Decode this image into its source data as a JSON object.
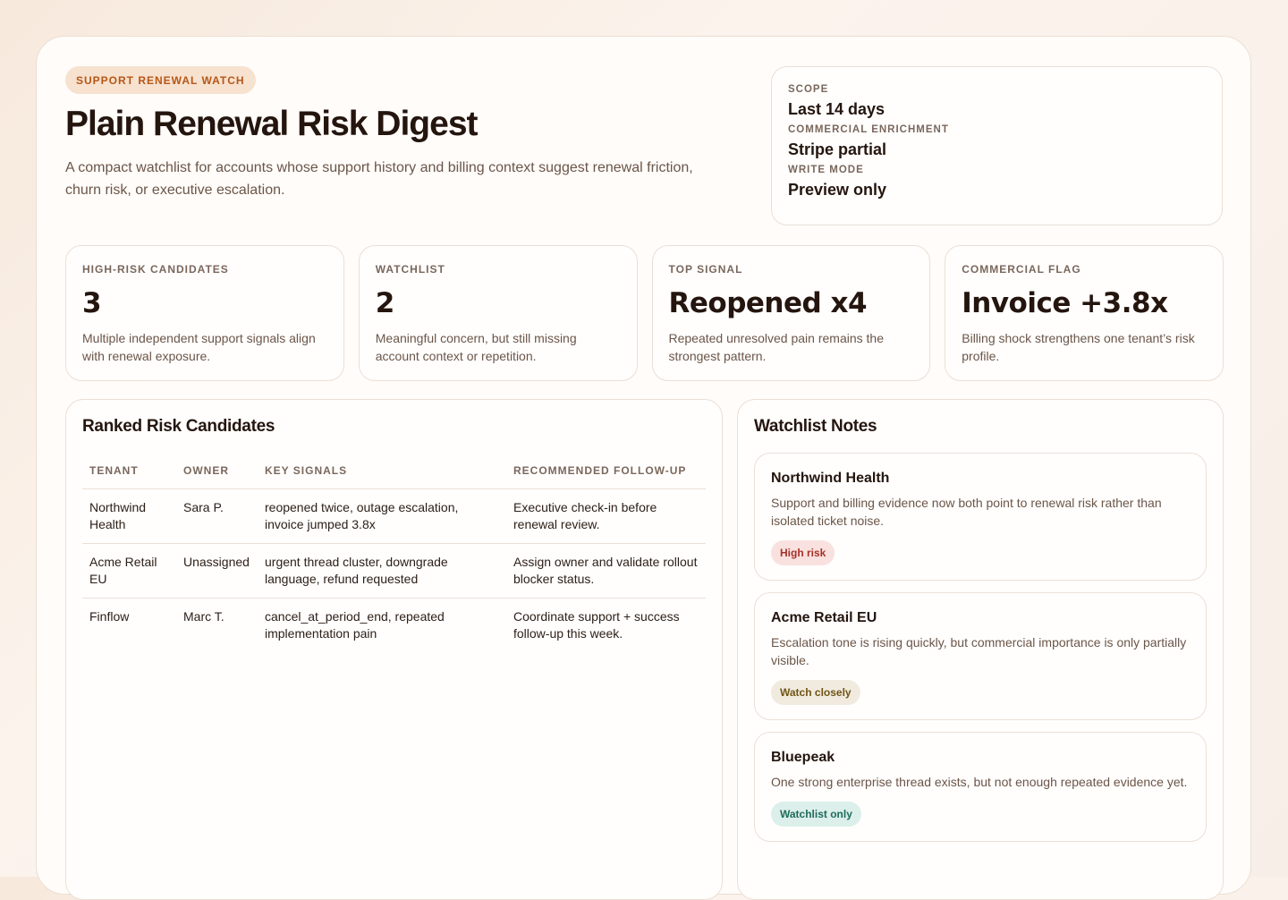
{
  "header": {
    "eyebrow": "SUPPORT RENEWAL WATCH",
    "title": "Plain Renewal Risk Digest",
    "subtitle": "A compact watchlist for accounts whose support history and billing context suggest renewal friction, churn risk, or executive escalation."
  },
  "scope": {
    "items": [
      {
        "label": "SCOPE",
        "value": "Last 14 days"
      },
      {
        "label": "COMMERCIAL ENRICHMENT",
        "value": "Stripe partial"
      },
      {
        "label": "WRITE MODE",
        "value": "Preview only"
      }
    ]
  },
  "stats": [
    {
      "label": "HIGH-RISK CANDIDATES",
      "value": "3",
      "desc": "Multiple independent support signals align with renewal exposure."
    },
    {
      "label": "WATCHLIST",
      "value": "2",
      "desc": "Meaningful concern, but still missing account context or repetition."
    },
    {
      "label": "TOP SIGNAL",
      "value": "Reopened x4",
      "desc": "Repeated unresolved pain remains the strongest pattern."
    },
    {
      "label": "COMMERCIAL FLAG",
      "value": "Invoice +3.8x",
      "desc": "Billing shock strengthens one tenant’s risk profile."
    }
  ],
  "candidates": {
    "title": "Ranked Risk Candidates",
    "columns": [
      "TENANT",
      "OWNER",
      "KEY SIGNALS",
      "RECOMMENDED FOLLOW-UP"
    ],
    "rows": [
      {
        "tenant": "Northwind Health",
        "owner": "Sara P.",
        "signals": "reopened twice, outage escalation, invoice jumped 3.8x",
        "followup": "Executive check-in before renewal review."
      },
      {
        "tenant": "Acme Retail EU",
        "owner": "Unassigned",
        "signals": "urgent thread cluster, downgrade language, refund requested",
        "followup": "Assign owner and validate rollout blocker status."
      },
      {
        "tenant": "Finflow",
        "owner": "Marc T.",
        "signals": "cancel_at_period_end, repeated implementation pain",
        "followup": "Coordinate support + success follow-up this week."
      }
    ]
  },
  "notes": {
    "title": "Watchlist Notes",
    "items": [
      {
        "name": "Northwind Health",
        "text": "Support and billing evidence now both point to renewal risk rather than isolated ticket noise.",
        "tag": "High risk",
        "tag_color": "#a8322a"
      },
      {
        "name": "Acme Retail EU",
        "text": "Escalation tone is rising quickly, but commercial importance is only partially visible.",
        "tag": "Watch closely",
        "tag_color": "#6f5414"
      },
      {
        "name": "Bluepeak",
        "text": "One strong enterprise thread exists, but not enough repeated evidence yet.",
        "tag": "Watchlist only",
        "tag_color": "#1f6b5c"
      }
    ]
  }
}
